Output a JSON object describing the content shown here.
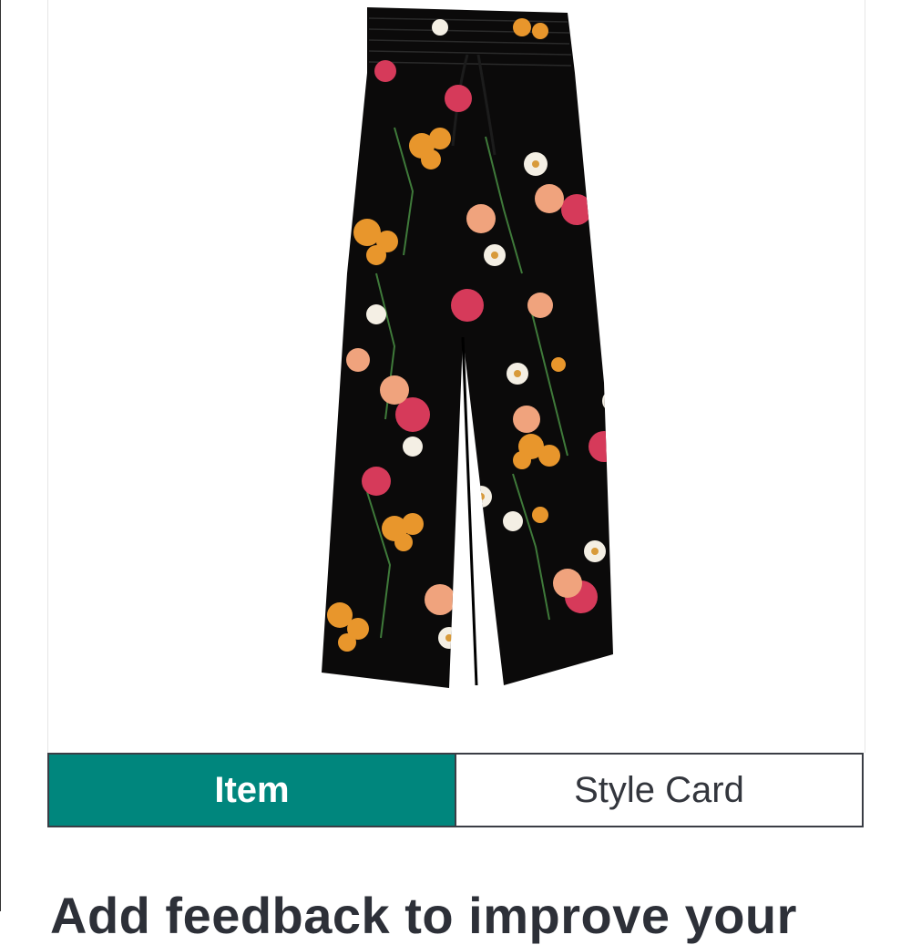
{
  "product": {
    "image_icon": "floral-wide-leg-pants-image",
    "colors": {
      "fabric": "#0b0a0a",
      "orange": "#e8962c",
      "pink": "#d63a5a",
      "peach": "#f0a37d",
      "cream": "#f4efe4",
      "leaf": "#3f7a3a"
    }
  },
  "tabs": [
    {
      "label": "Item",
      "active": true
    },
    {
      "label": "Style Card",
      "active": false
    }
  ],
  "accent_color": "#00867d",
  "feedback": {
    "heading": "Add feedback to improve your"
  }
}
